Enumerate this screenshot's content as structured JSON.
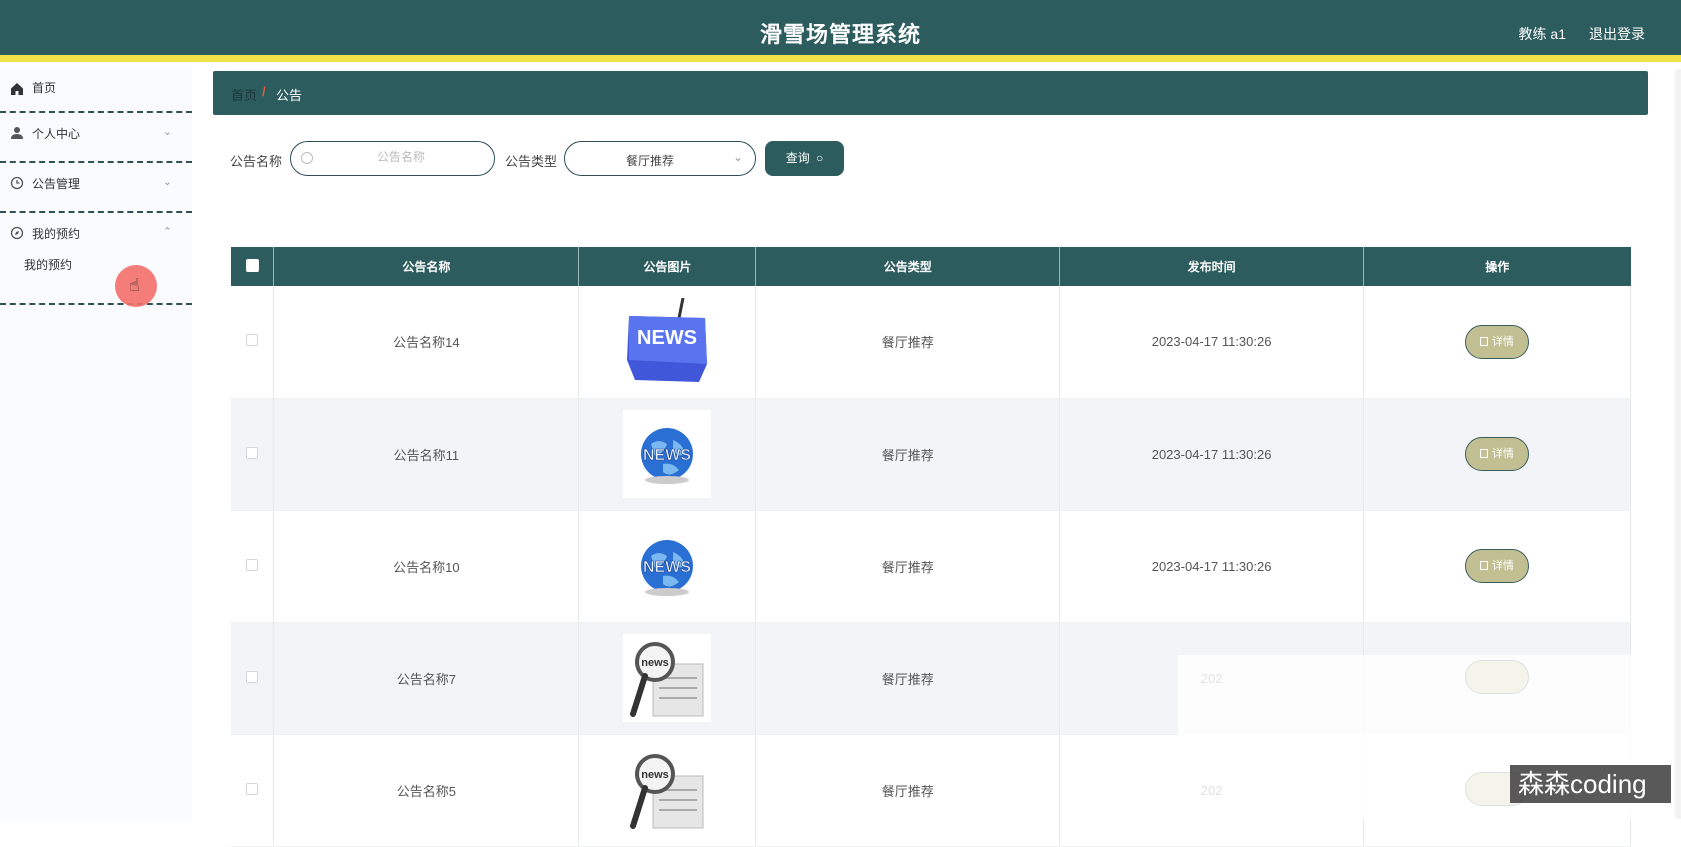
{
  "header": {
    "title": "滑雪场管理系统",
    "user": "教练 a1",
    "logout": "退出登录"
  },
  "sidebar": {
    "items": [
      {
        "label": "首页"
      },
      {
        "label": "个人中心"
      },
      {
        "label": "公告管理"
      },
      {
        "label": "我的预约",
        "sub": "我的预约"
      }
    ]
  },
  "breadcrumb": {
    "home": "首页",
    "sep": "/",
    "current": "公告"
  },
  "filters": {
    "name_label": "公告名称",
    "name_placeholder": "公告名称",
    "type_label": "公告类型",
    "type_value": "餐厅推荐",
    "query_label": "查询"
  },
  "table": {
    "headers": [
      "公告名称",
      "公告图片",
      "公告类型",
      "发布时间",
      "操作"
    ],
    "rows": [
      {
        "name": "公告名称14",
        "image": "news-key-icon",
        "type": "餐厅推荐",
        "time": "2023-04-17 11:30:26",
        "action": "详情"
      },
      {
        "name": "公告名称11",
        "image": "news-globe-icon",
        "type": "餐厅推荐",
        "time": "2023-04-17 11:30:26",
        "action": "详情"
      },
      {
        "name": "公告名称10",
        "image": "news-globe-icon",
        "type": "餐厅推荐",
        "time": "2023-04-17 11:30:26",
        "action": "详情"
      },
      {
        "name": "公告名称7",
        "image": "news-magnifier-icon",
        "type": "餐厅推荐",
        "time": "202",
        "action": ""
      },
      {
        "name": "公告名称5",
        "image": "news-magnifier-icon",
        "type": "餐厅推荐",
        "time": "202",
        "action": ""
      }
    ]
  },
  "watermark": "森森coding",
  "colors": {
    "primary": "#2d5c5e",
    "accent_bar": "#f2e34a",
    "detail_button": "#c2bf93"
  }
}
